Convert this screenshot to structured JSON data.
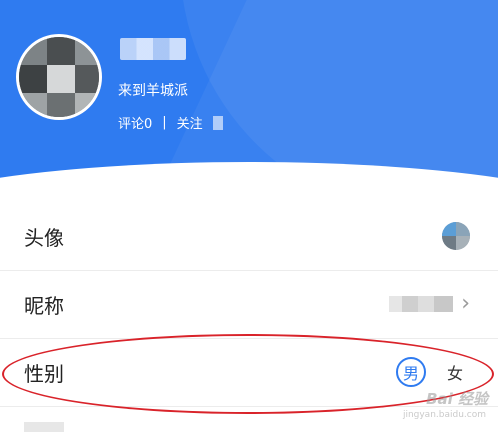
{
  "profile": {
    "welcome": "来到羊城派",
    "comments_label": "评论0",
    "separator": "|",
    "follow_label": "关注"
  },
  "settings": {
    "avatar_label": "头像",
    "nickname_label": "昵称",
    "gender_label": "性别",
    "gender_options": [
      "男",
      "女"
    ],
    "gender_selected": "男"
  },
  "icons": {
    "chevron": "chevron-right-icon"
  },
  "colors": {
    "header_blue": "#2f7bf0",
    "annotation_red": "#d9232a"
  },
  "watermark": {
    "brand": "Bai 经验",
    "sub": "jingyan.baidu.com"
  }
}
